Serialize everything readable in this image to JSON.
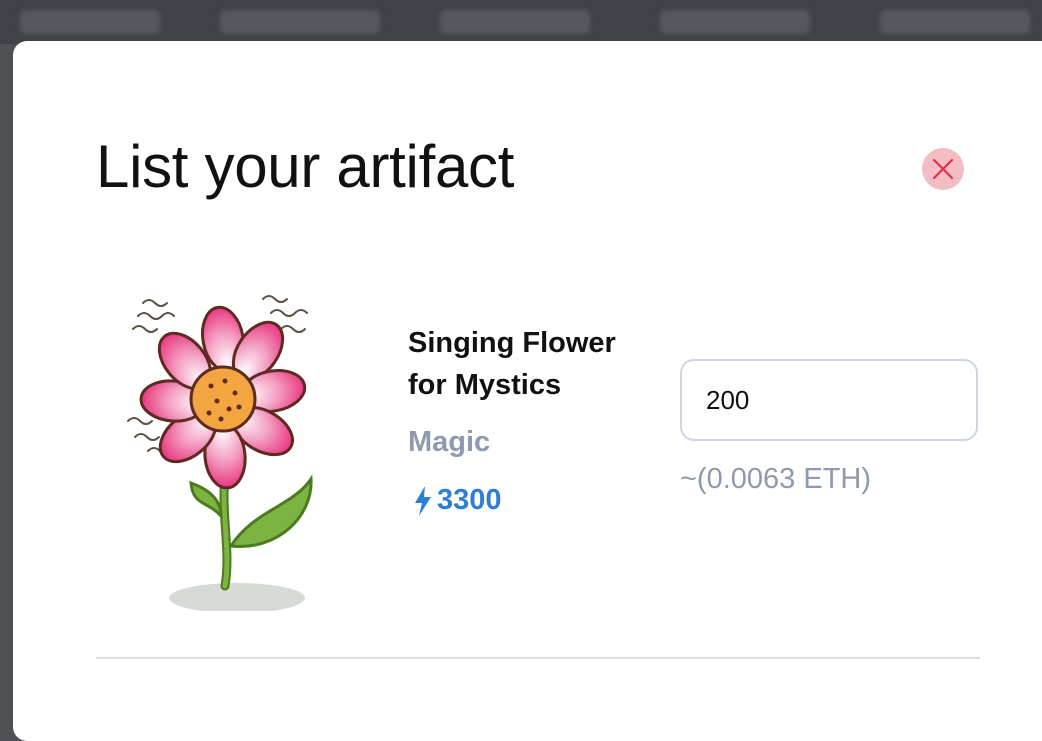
{
  "modal": {
    "title": "List your artifact",
    "close_icon": "close-icon"
  },
  "artifact": {
    "image_icon": "singing-flower-illustration",
    "name": "Singing Flower for Mystics",
    "category": "Magic",
    "power_icon": "lightning-bolt-icon",
    "power": "3300"
  },
  "price": {
    "value": "200",
    "eth_estimate": "~(0.0063 ETH)"
  },
  "colors": {
    "close_bg": "#f4bcc4",
    "close_x": "#d9344c",
    "category": "#8f9aae",
    "power": "#2e7fd4"
  }
}
